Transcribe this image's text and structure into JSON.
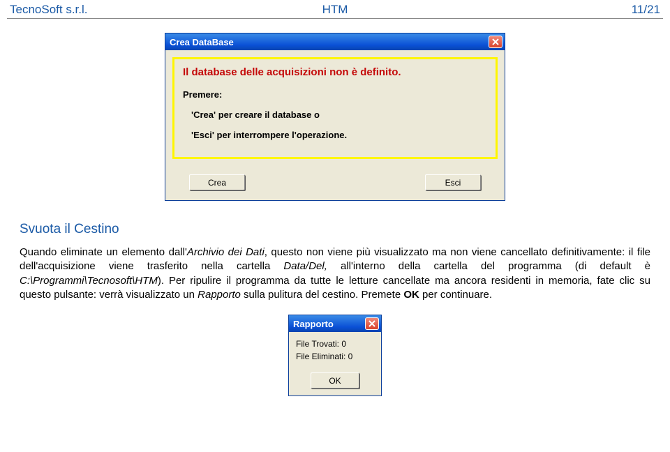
{
  "header": {
    "left": "TecnoSoft s.r.l.",
    "mid": "HTM",
    "right": "11/21"
  },
  "dialog1": {
    "title": "Crea DataBase",
    "alert": "Il database delle acquisizioni non è definito.",
    "premere": "Premere:",
    "opt1": "'Crea' per creare il database o",
    "opt2": "'Esci' per interrompere l'operazione.",
    "btn_crea": "Crea",
    "btn_esci": "Esci"
  },
  "doc": {
    "heading": "Svuota il Cestino",
    "p1_a": "Quando eliminate un elemento dall'",
    "p1_b": "Archivio dei Dati",
    "p1_c": ", questo non viene più visualizzato ma non viene cancellato definitivamente: il file dell'acquisizione viene trasferito nella cartella ",
    "p1_d": "Data/Del,",
    "p1_e": " all'interno della cartella del programma (di default è ",
    "p1_f": "C:\\Programmi\\Tecnosoft\\HTM",
    "p1_g": "). Per ripulire il programma da tutte le letture cancellate ma ancora residenti in memoria, fate clic su questo pulsante: verrà visualizzato un ",
    "p1_h": "Rapporto",
    "p1_i": " sulla pulitura del cestino. Premete ",
    "p1_j": "OK",
    "p1_k": " per continuare."
  },
  "dialog2": {
    "title": "Rapporto",
    "line1": "File Trovati:  0",
    "line2": "File Eliminati: 0",
    "btn_ok": "OK"
  }
}
